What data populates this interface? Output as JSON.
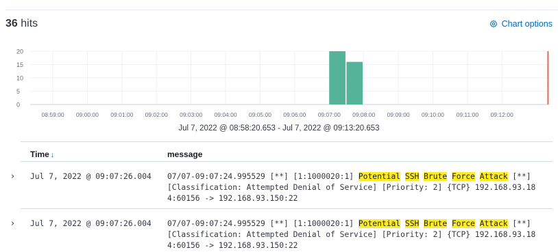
{
  "hits": {
    "count": "36",
    "label": "hits"
  },
  "chart_options_label": "Chart options",
  "icons": {
    "chart_options": "gear-icon",
    "sort": "arrow-down-icon",
    "expand": "chevron-right-icon"
  },
  "colors": {
    "bar": "#54b399",
    "now_marker": "#e7664c",
    "link": "#006bb8",
    "highlight": "#fdeb2a"
  },
  "chart_data": {
    "type": "bar",
    "y_ticks": [
      "20",
      "15",
      "10",
      "5",
      "0"
    ],
    "ylim": [
      0,
      20
    ],
    "x_ticks": [
      "08:59:00",
      "09:00:00",
      "09:01:00",
      "09:02:00",
      "09:03:00",
      "09:04:00",
      "09:05:00",
      "09:06:00",
      "09:07:00",
      "09:08:00",
      "09:09:00",
      "09:10:00",
      "09:11:00",
      "09:12:00"
    ],
    "bars": [
      {
        "x": "09:07:00",
        "value": 20
      },
      {
        "x": "09:07:30",
        "value": 16
      }
    ],
    "now_marker": "09:13:20",
    "grid": true
  },
  "time_range": "Jul 7, 2022 @ 08:58:20.653 - Jul 7, 2022 @ 09:13:20.653",
  "table": {
    "columns": [
      "Time",
      "message"
    ],
    "rows": [
      {
        "time": "Jul 7, 2022 @ 09:07:26.004",
        "line1_prefix": "07/07-09:07:24.995529  [**] [1:1000020:1] ",
        "highlights": [
          "Potential",
          "SSH",
          "Brute",
          "Force",
          "Attack"
        ],
        "line1_suffix": " [**]",
        "line2": "[Classification: Attempted Denial of Service] [Priority: 2] {TCP} 192.168.93.18",
        "line3": "4:60156 -> 192.168.93.150:22"
      },
      {
        "time": "Jul 7, 2022 @ 09:07:26.004",
        "line1_prefix": "07/07-09:07:24.995529  [**] [1:1000020:1] ",
        "highlights": [
          "Potential",
          "SSH",
          "Brute",
          "Force",
          "Attack"
        ],
        "line1_suffix": " [**]",
        "line2": "[Classification: Attempted Denial of Service] [Priority: 2] {TCP} 192.168.93.18",
        "line3": "4:60156 -> 192.168.93.150:22"
      }
    ]
  }
}
